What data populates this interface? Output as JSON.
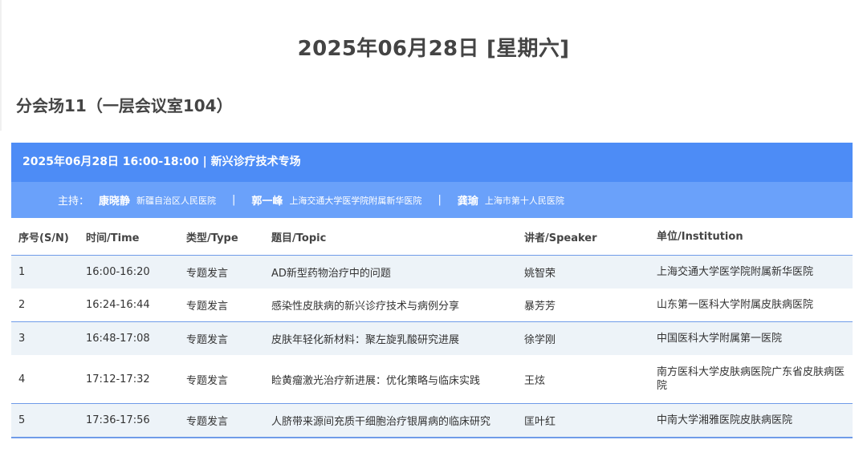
{
  "page": {
    "date_title": "2025年06月28日 [星期六]",
    "venue": "分会场11（一层会议室104）"
  },
  "session": {
    "title": "2025年06月28日 16:00-18:00 | 新兴诊疗技术专场",
    "host_label": "主持：",
    "separator": "|",
    "hosts": [
      {
        "name": "康晓静",
        "org": "新疆自治区人民医院"
      },
      {
        "name": "郭一峰",
        "org": "上海交通大学医学院附属新华医院"
      },
      {
        "name": "龚瑜",
        "org": "上海市第十人民医院"
      }
    ]
  },
  "table": {
    "headers": {
      "sn": "序号(S/N)",
      "time": "时间/Time",
      "type": "类型/Type",
      "topic": "题目/Topic",
      "speaker": "讲者/Speaker",
      "institution": "单位/Institution"
    },
    "rows": [
      {
        "sn": "1",
        "time": "16:00-16:20",
        "type": "专题发言",
        "topic": "AD新型药物治疗中的问题",
        "speaker": "姚智荣",
        "institution": "上海交通大学医学院附属新华医院"
      },
      {
        "sn": "2",
        "time": "16:24-16:44",
        "type": "专题发言",
        "topic": "感染性皮肤病的新兴诊疗技术与病例分享",
        "speaker": "暴芳芳",
        "institution": "山东第一医科大学附属皮肤病医院"
      },
      {
        "sn": "3",
        "time": "16:48-17:08",
        "type": "专题发言",
        "topic": "皮肤年轻化新材料：聚左旋乳酸研究进展",
        "speaker": "徐学刚",
        "institution": "中国医科大学附属第一医院"
      },
      {
        "sn": "4",
        "time": "17:12-17:32",
        "type": "专题发言",
        "topic": "睑黄瘤激光治疗新进展：优化策略与临床实践",
        "speaker": "王炫",
        "institution": "南方医科大学皮肤病医院广东省皮肤病医院"
      },
      {
        "sn": "5",
        "time": "17:36-17:56",
        "type": "专题发言",
        "topic": "人脐带来源间充质干细胞治疗银屑病的临床研究",
        "speaker": "匡叶红",
        "institution": "中南大学湘雅医院皮肤病医院"
      }
    ]
  }
}
